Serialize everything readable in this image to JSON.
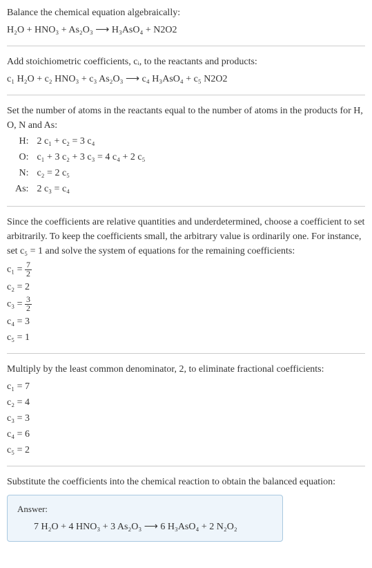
{
  "intro": {
    "line1": "Balance the chemical equation algebraically:",
    "equation": "H₂O + HNO₃ + As₂O₃  ⟶  H₃AsO₄ + N2O2"
  },
  "stoich": {
    "line1": "Add stoichiometric coefficients, cᵢ, to the reactants and products:",
    "equation": "c₁ H₂O + c₂ HNO₃ + c₃ As₂O₃  ⟶  c₄ H₃AsO₄ + c₅ N2O2"
  },
  "atoms": {
    "intro": "Set the number of atoms in the reactants equal to the number of atoms in the products for H, O, N and As:",
    "rows": [
      {
        "label": "H:",
        "eq": "2 c₁ + c₂ = 3 c₄"
      },
      {
        "label": "O:",
        "eq": "c₁ + 3 c₂ + 3 c₃ = 4 c₄ + 2 c₅"
      },
      {
        "label": "N:",
        "eq": "c₂ = 2 c₅"
      },
      {
        "label": "As:",
        "eq": "2 c₃ = c₄"
      }
    ]
  },
  "solve": {
    "intro": "Since the coefficients are relative quantities and underdetermined, choose a coefficient to set arbitrarily. To keep the coefficients small, the arbitrary value is ordinarily one. For instance, set c₅ = 1 and solve the system of equations for the remaining coefficients:",
    "coeffs": [
      {
        "lhs": "c₁ =",
        "num": "7",
        "den": "2"
      },
      {
        "lhs": "c₂ = 2"
      },
      {
        "lhs": "c₃ =",
        "num": "3",
        "den": "2"
      },
      {
        "lhs": "c₄ = 3"
      },
      {
        "lhs": "c₅ = 1"
      }
    ]
  },
  "multiply": {
    "intro": "Multiply by the least common denominator, 2, to eliminate fractional coefficients:",
    "coeffs": [
      "c₁ = 7",
      "c₂ = 4",
      "c₃ = 3",
      "c₄ = 6",
      "c₅ = 2"
    ]
  },
  "substitute": {
    "intro": "Substitute the coefficients into the chemical reaction to obtain the balanced equation:"
  },
  "answer": {
    "label": "Answer:",
    "equation": "7 H₂O + 4 HNO₃ + 3 As₂O₃  ⟶  6 H₃AsO₄ + 2 N₂O₂"
  },
  "chart_data": {
    "type": "table",
    "title": "Balanced chemical equation coefficients",
    "reactants": [
      {
        "species": "H2O",
        "coefficient": 7
      },
      {
        "species": "HNO3",
        "coefficient": 4
      },
      {
        "species": "As2O3",
        "coefficient": 3
      }
    ],
    "products": [
      {
        "species": "H3AsO4",
        "coefficient": 6
      },
      {
        "species": "N2O2",
        "coefficient": 2
      }
    ],
    "atom_balance_equations": {
      "H": "2c1 + c2 = 3c4",
      "O": "c1 + 3c2 + 3c3 = 4c4 + 2c5",
      "N": "c2 = 2c5",
      "As": "2c3 = c4"
    },
    "initial_solution_c5_1": {
      "c1": 3.5,
      "c2": 2,
      "c3": 1.5,
      "c4": 3,
      "c5": 1
    },
    "scaled_solution": {
      "c1": 7,
      "c2": 4,
      "c3": 3,
      "c4": 6,
      "c5": 2
    }
  }
}
